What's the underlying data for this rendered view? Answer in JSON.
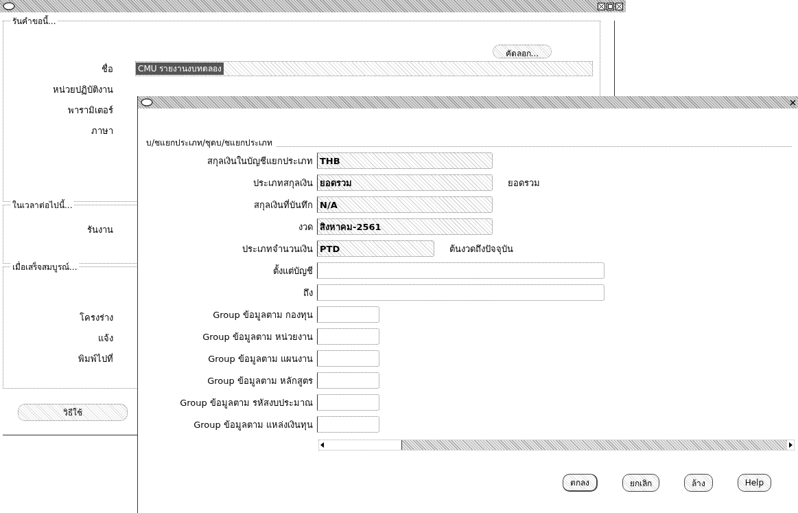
{
  "back_window": {
    "sections": [
      {
        "title": "รันคำขอนี้...",
        "action_button": "คัดลอก...",
        "fields": [
          {
            "label": "ชื่อ",
            "value": "CMU รายงานงบทดลอง",
            "selected": true
          },
          {
            "label": "หน่วยปฏิบัติงาน"
          },
          {
            "label": "พารามิเตอร์"
          },
          {
            "label": "ภาษา"
          }
        ]
      },
      {
        "title": "ในเวลาต่อไปนี้...",
        "fields": [
          {
            "label": "รันงาน"
          }
        ]
      },
      {
        "title": "เมื่อเสร็จสมบูรณ์...",
        "fields": [
          {
            "label": "โครงร่าง"
          },
          {
            "label": "แจ้ง"
          },
          {
            "label": "พิมพ์ไปที่"
          }
        ]
      }
    ],
    "help_button": "วิธีใช้"
  },
  "dialog": {
    "section_label": "บ/ชแยกประเภท/ชุดบ/ชแยกประเภท",
    "fields": [
      {
        "label": "สกุลเงินในบัญชีแยกประเภท",
        "value": "THB",
        "kind": "medium",
        "disabled": true
      },
      {
        "label": "ประเภทสกุลเงิน",
        "value": "ยอดรวม",
        "kind": "medium",
        "disabled": true,
        "note": "ยอดรวม"
      },
      {
        "label": "สกุลเงินที่บันทึก",
        "value": "N/A",
        "kind": "medium",
        "disabled": true
      },
      {
        "label": "งวด",
        "value": "สิงหาคม-2561",
        "kind": "medium",
        "disabled": true
      },
      {
        "label": "ประเภทจำนวนเงิน",
        "value": "PTD",
        "kind": "short",
        "disabled": true,
        "note": "ต้นงวดถึงปัจจุบัน"
      },
      {
        "label": "ตั้งแต่บัญชี",
        "kind": "long",
        "disabled": false
      },
      {
        "label": "ถึง",
        "kind": "long",
        "disabled": false
      },
      {
        "label": "Group ข้อมูลตาม กองทุน",
        "kind": "small",
        "disabled": false
      },
      {
        "label": "Group ข้อมูลตาม หน่วยงาน",
        "kind": "small",
        "disabled": false
      },
      {
        "label": "Group ข้อมูลตาม แผนงาน",
        "kind": "small",
        "disabled": false
      },
      {
        "label": "Group ข้อมูลตาม หลักสูตร",
        "kind": "small",
        "disabled": false
      },
      {
        "label": "Group ข้อมูลตาม รหัสงบประมาณ",
        "kind": "small",
        "disabled": false
      },
      {
        "label": "Group ข้อมูลตาม แหล่งเงินทุน",
        "kind": "small",
        "disabled": false
      }
    ],
    "buttons": [
      "ตกลง",
      "ยกเลิก",
      "ล้าง",
      "Help"
    ]
  }
}
